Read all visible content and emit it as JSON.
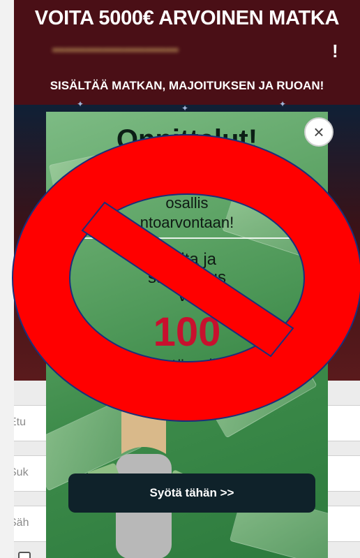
{
  "banner": {
    "title": "VOITA 5000€ ARVOINEN MATKA",
    "exclamation": "!",
    "subtitle": "SISÄLTÄÄ MATKAN, MAJOITUKSEN JA RUOAN!"
  },
  "form": {
    "fields": [
      {
        "placeholder": "Etu"
      },
      {
        "placeholder": "Suk"
      },
      {
        "placeholder": "Säh"
      }
    ]
  },
  "popup": {
    "title": "Onnittelut!",
    "close_icon": "×",
    "lines": [
      "osallis",
      "ntoarvontaan!",
      "a alta ja",
      "saa        llisuus",
      "vo"
    ],
    "amount": "100",
    "prize_line": "edestä palkint",
    "cta_label": "Syötä tähän >>"
  },
  "colors": {
    "banner_bg": "#4a0f16",
    "popup_green": "#3d8b4a",
    "cta_bg": "#0f222a",
    "amount_red": "#c8102e",
    "prohibition_red": "#ff0000"
  },
  "icons": [
    "close-icon",
    "prohibition-sign-icon",
    "checkbox-icon"
  ]
}
